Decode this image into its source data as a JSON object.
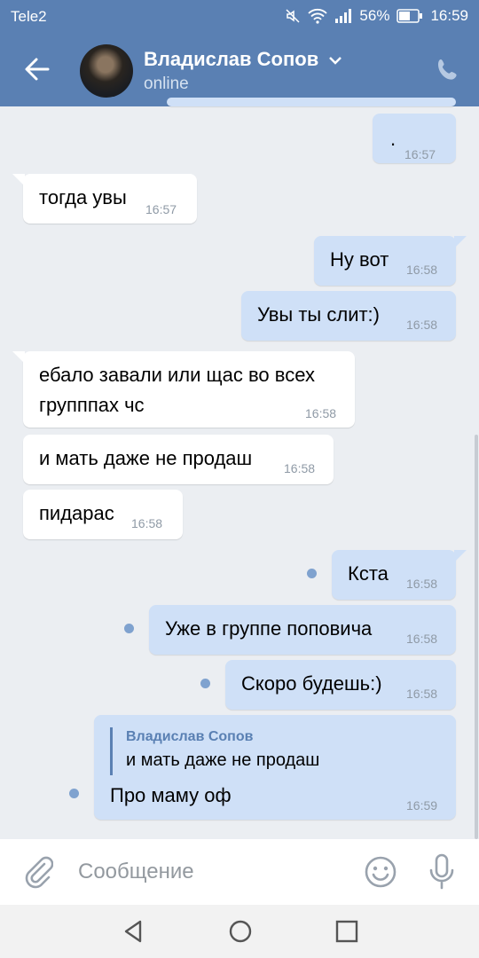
{
  "status_bar": {
    "carrier": "Tele2",
    "battery": "56%",
    "time": "16:59"
  },
  "header": {
    "name": "Владислав Сопов",
    "status": "online"
  },
  "messages": [
    {
      "dir": "out",
      "text": ".",
      "time": "16:57"
    },
    {
      "dir": "in",
      "text": "тогда увы",
      "time": "16:57"
    },
    {
      "dir": "out",
      "text": "Ну вот",
      "time": "16:58"
    },
    {
      "dir": "out",
      "text": "Увы ты слит:)",
      "time": "16:58"
    },
    {
      "dir": "in",
      "text": "ебало завали или щас во всех",
      "text2": "групппах чс",
      "time": "16:58"
    },
    {
      "dir": "in",
      "text": "и мать даже не продаш",
      "time": "16:58"
    },
    {
      "dir": "in",
      "text": "пидарас",
      "time": "16:58"
    },
    {
      "dir": "out",
      "text": "Кста",
      "time": "16:58",
      "unread": true
    },
    {
      "dir": "out",
      "text": "Уже в группе поповича",
      "time": "16:58",
      "unread": true
    },
    {
      "dir": "out",
      "text": "Скоро будешь:)",
      "time": "16:58",
      "unread": true
    },
    {
      "dir": "out",
      "reply_author": "Владислав Сопов",
      "reply_text": "и мать даже не продаш",
      "text": "Про маму оф",
      "time": "16:59",
      "unread": true
    }
  ],
  "composer": {
    "placeholder": "Сообщение"
  },
  "colors": {
    "header": "#5a80b3",
    "outgoing": "#cfe0f7",
    "incoming": "#ffffff",
    "background": "#ebeef2"
  }
}
